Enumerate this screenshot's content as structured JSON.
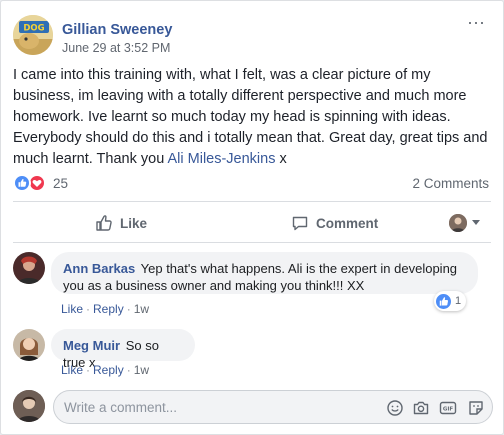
{
  "post": {
    "author": "Gillian Sweeney",
    "avatar_text": "DOG",
    "time": "June 29 at 3:52 PM",
    "more_label": "···",
    "body_text": "I came into this training with, what I felt, was a clear picture of my business, im leaving with a totally different perspective and much more homework. Ive learnt so much today my head is spinning with ideas. Everybody should do this and i totally mean that. Great day, great tips and much learnt. Thank you ",
    "mention": "Ali Miles-Jenkins",
    "body_suffix": " x"
  },
  "reactions": {
    "count": "25",
    "comments_label": "2 Comments",
    "types": [
      "like-icon",
      "love-icon"
    ],
    "colors": {
      "like": "#4e8ef7",
      "love": "#f0384f"
    }
  },
  "actions": {
    "like_label": "Like",
    "comment_label": "Comment"
  },
  "comments": [
    {
      "author": "Ann Barkas",
      "text": "Yep that's what happens. Ali is the expert in developing you as a business owner and making you think!!! XX",
      "like_label": "Like",
      "reply_label": "Reply",
      "time": "1w",
      "reaction_count": "1"
    },
    {
      "author": "Meg Muir",
      "text": "So so true x",
      "like_label": "Like",
      "reply_label": "Reply",
      "time": "1w"
    }
  ],
  "composer": {
    "placeholder": "Write a comment...",
    "tools": [
      "emoji-icon",
      "camera-icon",
      "gif-icon",
      "sticker-icon"
    ]
  },
  "theme": {
    "link": "#385898",
    "meta": "#606770",
    "bubble": "#f2f3f5"
  }
}
